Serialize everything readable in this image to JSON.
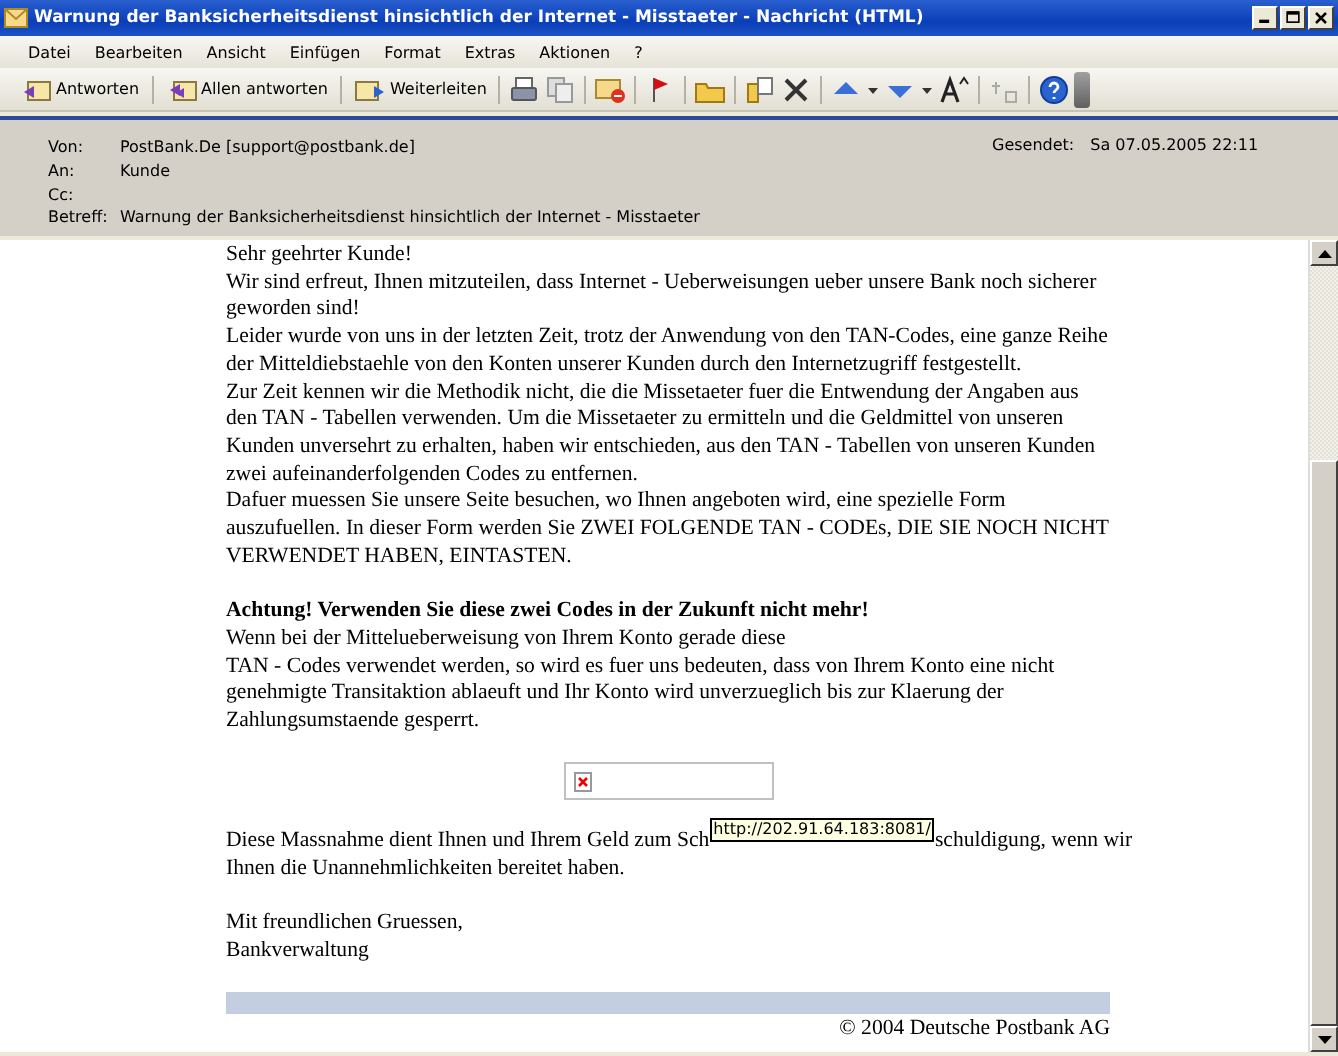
{
  "window": {
    "title": "Warnung der Banksicherheitsdienst hinsichtlich der Internet - Misstaeter - Nachricht (HTML)"
  },
  "menu": [
    "Datei",
    "Bearbeiten",
    "Ansicht",
    "Einfügen",
    "Format",
    "Extras",
    "Aktionen",
    "?"
  ],
  "toolbar": {
    "buttons": [
      "Antworten",
      "Allen antworten",
      "Weiterleiten"
    ]
  },
  "header": {
    "fields": [
      {
        "label": "Von:",
        "value": "PostBank.De [support@postbank.de]"
      },
      {
        "label": "An:",
        "value": "Kunde"
      },
      {
        "label": "Cc:"
      },
      {
        "label": "Betreff:",
        "value": "Warnung der Banksicherheitsdienst hinsichtlich der Internet - Misstaeter"
      }
    ],
    "sent": {
      "label": "Gesendet:",
      "value": "Sa 07.05.2005 22:11"
    }
  },
  "sections": [
    [
      {
        "kind": "text",
        "text": "Sehr geehrter Kunde!"
      },
      {
        "kind": "text",
        "text": "Wir sind erfreut, Ihnen mitzuteilen, dass Internet - Ueberweisungen ueber unsere Bank noch sicherer geworden sind!"
      },
      {
        "kind": "text",
        "text": "Leider wurde von uns in der letzten Zeit, trotz der Anwendung von den TAN-Codes, eine ganze Reihe der Mitteldiebstaehle von den Konten unserer Kunden durch den Internetzugriff festgestellt."
      },
      {
        "kind": "text",
        "text": "Zur Zeit kennen wir die Methodik nicht, die die Missetaeter fuer die Entwendung der Angaben aus den TAN - Tabellen verwenden. Um die Missetaeter zu ermitteln und die Geldmittel von unseren Kunden unversehrt zu erhalten, haben wir entschieden, aus den TAN - Tabellen von unseren Kunden zwei aufeinanderfolgenden Codes zu entfernen."
      },
      {
        "kind": "text",
        "text": "Dafuer muessen Sie unsere Seite besuchen, wo Ihnen angeboten wird, eine spezielle Form auszufuellen. In dieser Form werden Sie ZWEI FOLGENDE TAN - CODEs, DIE SIE NOCH NICHT VERWENDET HABEN, EINTASTEN."
      }
    ],
    [
      {
        "kind": "heading",
        "text": "Achtung! Verwenden Sie diese zwei Codes in der Zukunft nicht mehr!"
      },
      {
        "kind": "text",
        "text": "Wenn bei der Mittelueberweisung von Ihrem Konto gerade diese"
      },
      {
        "kind": "text",
        "text": "TAN - Codes verwendet werden, so wird es fuer uns bedeuten, dass von Ihrem Konto eine nicht genehmigte Transitaktion ablaeuft und Ihr Konto wird unverzueglich bis zur Klaerung der Zahlungsumstaende gesperrt."
      }
    ],
    [
      {
        "kind": "image"
      }
    ],
    [
      {
        "kind": "covered",
        "before": "Diese Massnahme dient Ihnen und Ihrem Geld zum Sch",
        "tooltip": "http://202.91.64.183:8081/",
        "after": "schuldigung, wenn wir",
        "rest": "Ihnen die Unannehmlichkeiten bereitet haben."
      }
    ],
    [
      {
        "kind": "text",
        "text": "Mit freundlichen Gruessen,"
      },
      {
        "kind": "text",
        "text": "Bankverwaltung"
      }
    ]
  ],
  "footer": {
    "copyright": "© 2004 Deutsche Postbank AG"
  }
}
